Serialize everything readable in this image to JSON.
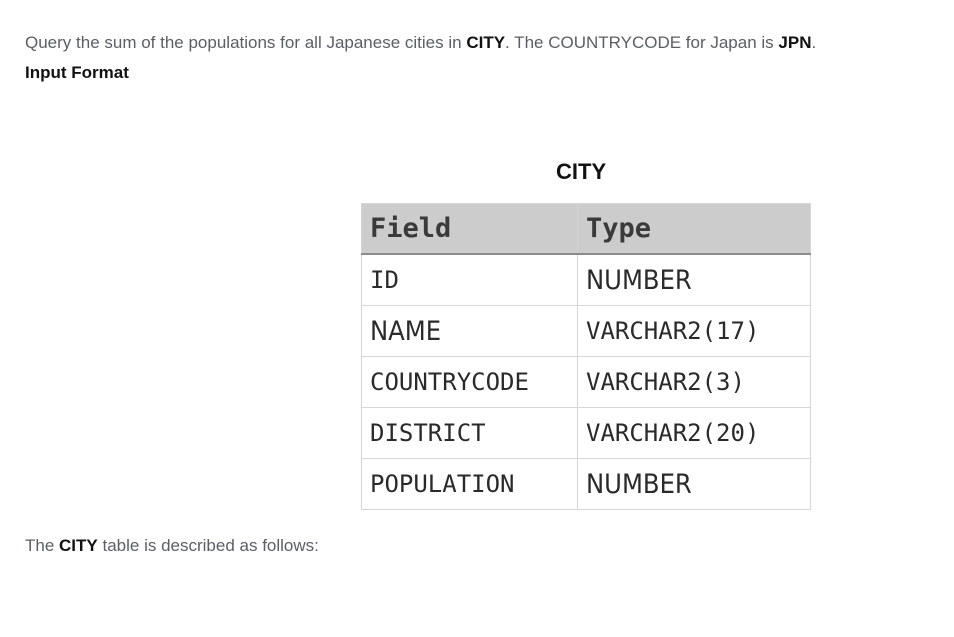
{
  "intro": {
    "text_1": "Query the sum of the populations for all Japanese cities in ",
    "table_name": "CITY",
    "text_2": ". The COUNTRYCODE for Japan is ",
    "code": "JPN",
    "text_3": "."
  },
  "input_format": {
    "heading": "Input Format"
  },
  "table": {
    "caption": "CITY",
    "headers": [
      "Field",
      "Type"
    ],
    "rows": [
      {
        "field": "ID",
        "type": "NUMBER"
      },
      {
        "field": "NAME",
        "type": "VARCHAR2(17)"
      },
      {
        "field": "COUNTRYCODE",
        "type": "VARCHAR2(3)"
      },
      {
        "field": "DISTRICT",
        "type": "VARCHAR2(20)"
      },
      {
        "field": "POPULATION",
        "type": "NUMBER"
      }
    ]
  },
  "description": {
    "text_1": "The ",
    "table_name": "CITY",
    "text_2": " table is described as follows:"
  }
}
